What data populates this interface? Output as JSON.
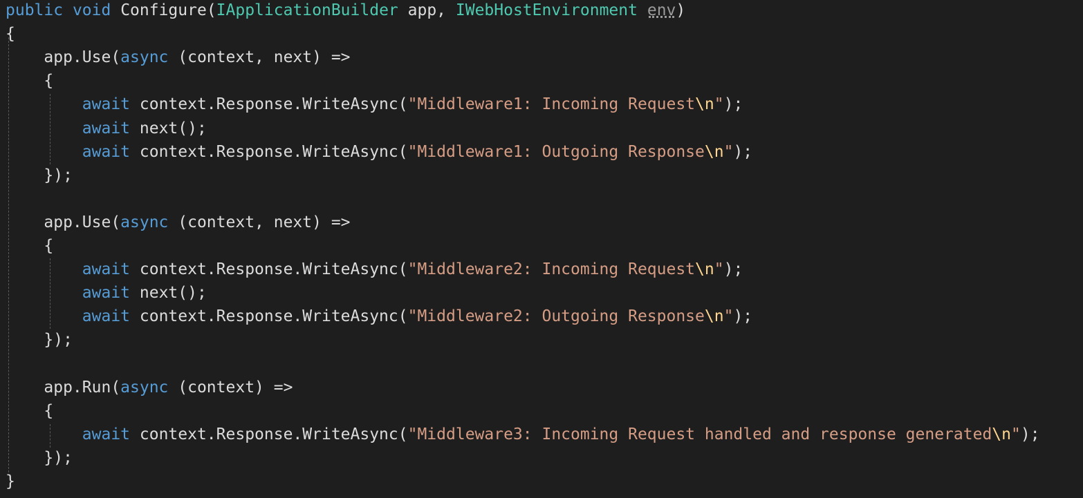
{
  "lines": [
    [
      {
        "c": "kw",
        "t": "public"
      },
      {
        "c": "plain",
        "t": " "
      },
      {
        "c": "kw",
        "t": "void"
      },
      {
        "c": "plain",
        "t": " Configure("
      },
      {
        "c": "type",
        "t": "IApplicationBuilder"
      },
      {
        "c": "plain",
        "t": " app, "
      },
      {
        "c": "type",
        "t": "IWebHostEnvironment"
      },
      {
        "c": "plain",
        "t": " "
      },
      {
        "c": "env",
        "t": "env"
      },
      {
        "c": "plain",
        "t": ")"
      }
    ],
    [
      {
        "c": "plain",
        "t": "{"
      }
    ],
    [
      {
        "c": "plain",
        "t": "    app.Use("
      },
      {
        "c": "kw",
        "t": "async"
      },
      {
        "c": "plain",
        "t": " (context, next) =>"
      }
    ],
    [
      {
        "c": "plain",
        "t": "    {"
      }
    ],
    [
      {
        "c": "plain",
        "t": "        "
      },
      {
        "c": "kw",
        "t": "await"
      },
      {
        "c": "plain",
        "t": " context.Response.WriteAsync("
      },
      {
        "c": "str",
        "t": "\"Middleware1: Incoming Request"
      },
      {
        "c": "esc",
        "t": "\\n"
      },
      {
        "c": "str",
        "t": "\""
      },
      {
        "c": "plain",
        "t": ");"
      }
    ],
    [
      {
        "c": "plain",
        "t": "        "
      },
      {
        "c": "kw",
        "t": "await"
      },
      {
        "c": "plain",
        "t": " next();"
      }
    ],
    [
      {
        "c": "plain",
        "t": "        "
      },
      {
        "c": "kw",
        "t": "await"
      },
      {
        "c": "plain",
        "t": " context.Response.WriteAsync("
      },
      {
        "c": "str",
        "t": "\"Middleware1: Outgoing Response"
      },
      {
        "c": "esc",
        "t": "\\n"
      },
      {
        "c": "str",
        "t": "\""
      },
      {
        "c": "plain",
        "t": ");"
      }
    ],
    [
      {
        "c": "plain",
        "t": "    });"
      }
    ],
    [],
    [
      {
        "c": "plain",
        "t": "    app.Use("
      },
      {
        "c": "kw",
        "t": "async"
      },
      {
        "c": "plain",
        "t": " (context, next) =>"
      }
    ],
    [
      {
        "c": "plain",
        "t": "    {"
      }
    ],
    [
      {
        "c": "plain",
        "t": "        "
      },
      {
        "c": "kw",
        "t": "await"
      },
      {
        "c": "plain",
        "t": " context.Response.WriteAsync("
      },
      {
        "c": "str",
        "t": "\"Middleware2: Incoming Request"
      },
      {
        "c": "esc",
        "t": "\\n"
      },
      {
        "c": "str",
        "t": "\""
      },
      {
        "c": "plain",
        "t": ");"
      }
    ],
    [
      {
        "c": "plain",
        "t": "        "
      },
      {
        "c": "kw",
        "t": "await"
      },
      {
        "c": "plain",
        "t": " next();"
      }
    ],
    [
      {
        "c": "plain",
        "t": "        "
      },
      {
        "c": "kw",
        "t": "await"
      },
      {
        "c": "plain",
        "t": " context.Response.WriteAsync("
      },
      {
        "c": "str",
        "t": "\"Middleware2: Outgoing Response"
      },
      {
        "c": "esc",
        "t": "\\n"
      },
      {
        "c": "str",
        "t": "\""
      },
      {
        "c": "plain",
        "t": ");"
      }
    ],
    [
      {
        "c": "plain",
        "t": "    });"
      }
    ],
    [],
    [
      {
        "c": "plain",
        "t": "    app.Run("
      },
      {
        "c": "kw",
        "t": "async"
      },
      {
        "c": "plain",
        "t": " (context) =>"
      }
    ],
    [
      {
        "c": "plain",
        "t": "    {"
      }
    ],
    [
      {
        "c": "plain",
        "t": "        "
      },
      {
        "c": "kw",
        "t": "await"
      },
      {
        "c": "plain",
        "t": " context.Response.WriteAsync("
      },
      {
        "c": "str",
        "t": "\"Middleware3: Incoming Request handled and response generated"
      },
      {
        "c": "esc",
        "t": "\\n"
      },
      {
        "c": "str",
        "t": "\""
      },
      {
        "c": "plain",
        "t": ");"
      }
    ],
    [
      {
        "c": "plain",
        "t": "    });"
      }
    ],
    [
      {
        "c": "plain",
        "t": "}"
      }
    ]
  ],
  "colors": {
    "background": "#1e1e1e",
    "keyword": "#569cd6",
    "type": "#4ec9b0",
    "string": "#d69d85",
    "escape": "#ffd68f",
    "plain": "#dcdcdc",
    "unused_parameter": "#9a9a9a"
  }
}
